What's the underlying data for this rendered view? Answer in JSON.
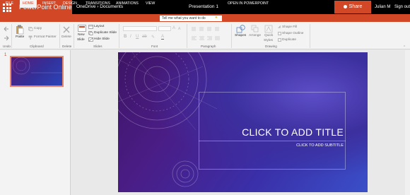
{
  "app": {
    "brand": "PowerPoint Online",
    "breadcrumb": "OneDrive › Documents",
    "doc_title": "Presentation 1",
    "share_label": "Share",
    "user_name": "Julian M",
    "sign_out": "Sign out"
  },
  "tabs": [
    {
      "label": "FILE"
    },
    {
      "label": "HOME",
      "active": true
    },
    {
      "label": "INSERT"
    },
    {
      "label": "DESIGN"
    },
    {
      "label": "TRANSITIONS"
    },
    {
      "label": "ANIMATIONS"
    },
    {
      "label": "VIEW"
    }
  ],
  "tellme": {
    "placeholder": "Tell me what you want to do"
  },
  "open_in": "OPEN IN POWERPOINT",
  "ribbon": {
    "groups": {
      "undo": "Undo",
      "clipboard": "Clipboard",
      "delete": "Delete",
      "slides": "Slides",
      "font": "Font",
      "paragraph": "Paragraph",
      "drawing": "Drawing"
    },
    "paste": "Paste",
    "copy": "Copy",
    "format_painter": "Format Painter",
    "delete_btn": "Delete",
    "new_slide": [
      "New",
      "Slide"
    ],
    "layout": "Layout",
    "duplicate_slide": "Duplicate Slide",
    "hide_slide": "Hide Slide",
    "shapes": "Shapes",
    "arrange": "Arrange",
    "quick_styles": [
      "Quick",
      "Styles"
    ],
    "shape_fill": "Shape Fill",
    "shape_outline": "Shape Outline",
    "duplicate": "Duplicate"
  },
  "thumbnail": {
    "number": "1"
  },
  "slide": {
    "title": "CLICK TO ADD TITLE",
    "subtitle": "CLICK TO ADD SUBTITLE"
  },
  "colors": {
    "accent": "#d24726",
    "topbar": "#000000",
    "slide_gradient_start": "#3d1465",
    "slide_gradient_end": "#3a4fc8"
  }
}
